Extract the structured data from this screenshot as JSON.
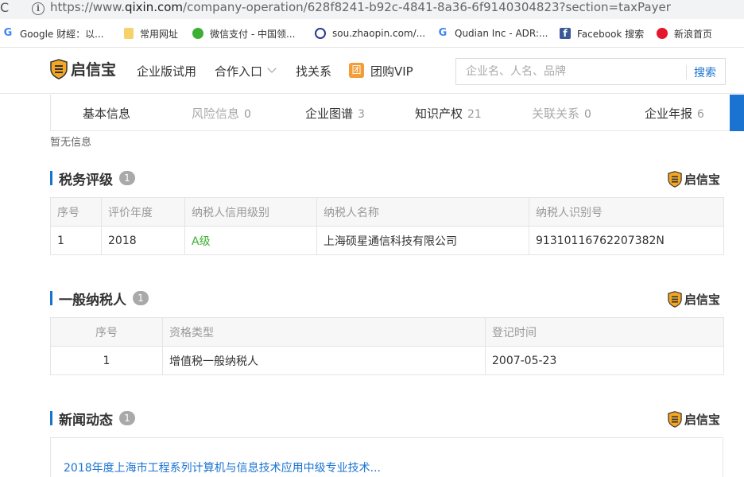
{
  "browser": {
    "url_prefix": "https://www.",
    "url_host": "qixin.com",
    "url_path": "/company-operation/628f8241-b92c-4841-8a36-6f9140304823?section=taxPayer"
  },
  "bookmarks": [
    {
      "label": "Google 财經：以...",
      "icon": "google-icon"
    },
    {
      "label": "常用网址",
      "icon": "folder-icon"
    },
    {
      "label": "微信支付 - 中国领...",
      "icon": "wechat-icon"
    },
    {
      "label": "sou.zhaopin.com/...",
      "icon": "globe-icon"
    },
    {
      "label": "Qudian Inc - ADR:...",
      "icon": "google-icon"
    },
    {
      "label": "Facebook 搜索",
      "icon": "facebook-icon"
    },
    {
      "label": "新浪首页",
      "icon": "weibo-icon"
    }
  ],
  "header": {
    "logo_text": "启信宝",
    "nav": {
      "enterprise_trial": "企业版试用",
      "partner_entry": "合作入口",
      "find_relation": "找关系",
      "group_vip": "团购VIP",
      "vip_icon_char": "团"
    },
    "search": {
      "placeholder": "企业名、人名、品牌",
      "button": "搜索"
    }
  },
  "tabs": [
    {
      "label": "基本信息",
      "count": ""
    },
    {
      "label": "风险信息",
      "count": "0"
    },
    {
      "label": "企业图谱",
      "count": "3"
    },
    {
      "label": "知识产权",
      "count": "21"
    },
    {
      "label": "关联关系",
      "count": "0"
    },
    {
      "label": "企业年报",
      "count": "6"
    }
  ],
  "no_info_text": "暂无信息",
  "brand_text": "启信宝",
  "tax_rating": {
    "title": "税务评级",
    "count": "1",
    "headers": [
      "序号",
      "评价年度",
      "纳税人信用级别",
      "纳税人名称",
      "纳税人识别号"
    ],
    "rows": [
      {
        "no": "1",
        "year": "2018",
        "level": "A级",
        "name": "上海硕星通信科技有限公司",
        "tax_id": "91310116762207382N"
      }
    ]
  },
  "general_taxpayer": {
    "title": "一般纳税人",
    "count": "1",
    "headers": [
      "序号",
      "资格类型",
      "登记时间"
    ],
    "rows": [
      {
        "no": "1",
        "type": "增值税一般纳税人",
        "date": "2007-05-23"
      }
    ]
  },
  "news": {
    "title": "新闻动态",
    "count": "1",
    "items": [
      {
        "title": "2018年度上海市工程系列计算机与信息技术应用中级专业技术..."
      }
    ]
  },
  "colors": {
    "accent": "#1b73d1",
    "green": "#3cb034",
    "badge": "#a9a9a9",
    "logo_gold": "#f5a623"
  }
}
